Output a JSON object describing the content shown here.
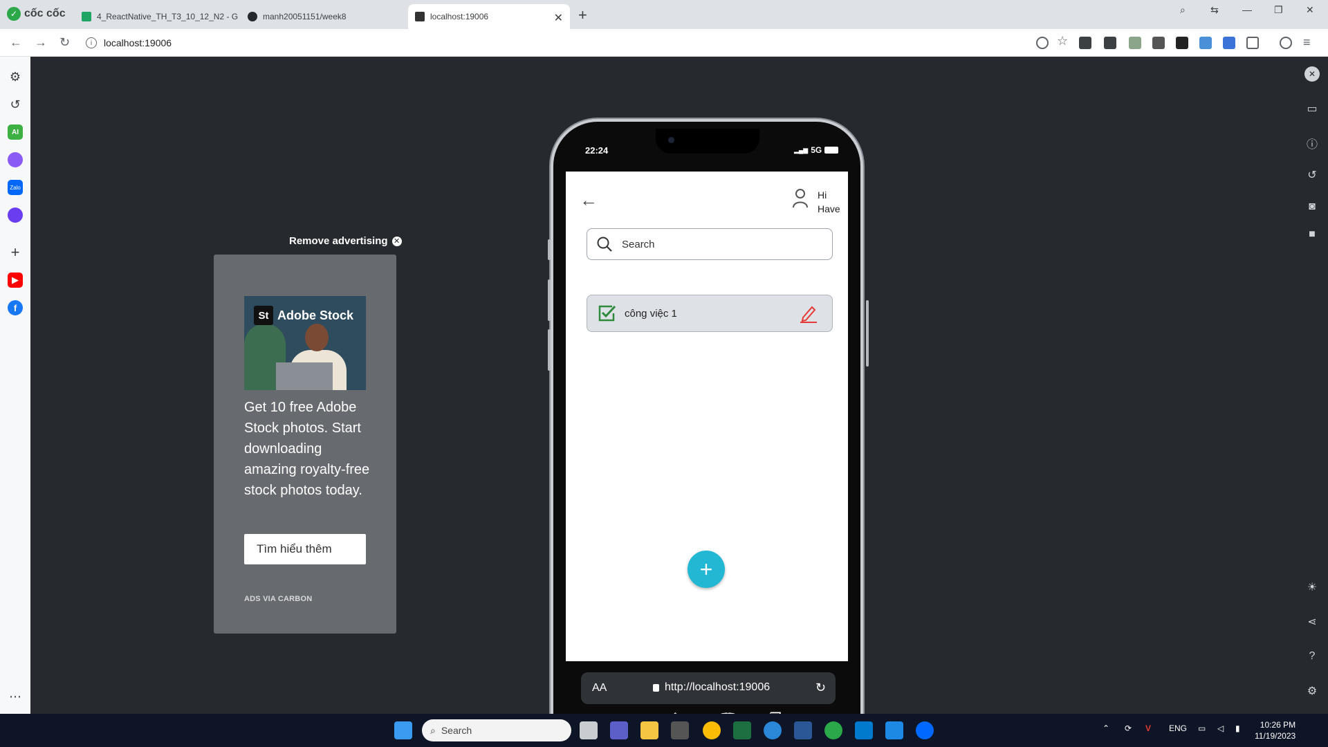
{
  "browser": {
    "brand": "cốc cốc",
    "tabs": [
      {
        "title": "4_ReactNative_TH_T3_10_12_N2 - Gc"
      },
      {
        "title": "manh20051151/week8"
      },
      {
        "title": "localhost:19006"
      }
    ],
    "address": "localhost:19006"
  },
  "ad": {
    "remove_label": "Remove advertising",
    "brand": "Adobe Stock",
    "brand_mark": "St",
    "text": "Get 10 free Adobe Stock photos. Start downloading amazing royalty-free stock photos today.",
    "button": "Tìm hiểu thêm",
    "footer": "ADS VIA CARBON"
  },
  "phone": {
    "time": "22:24",
    "network": "5G",
    "greeting_line1": "Hi",
    "greeting_line2": "Have",
    "search_placeholder": "Search",
    "tasks": [
      {
        "title": "công việc 1",
        "done": true
      }
    ],
    "safari": {
      "aa": "AA",
      "url": "http://localhost:19006"
    }
  },
  "taskbar": {
    "search": "Search",
    "lang": "ENG",
    "time": "10:26 PM",
    "date": "11/19/2023"
  },
  "colors": {
    "fab": "#22b7d3",
    "check": "#2e8b3a",
    "pencil": "#e53935",
    "stage": "#262a2e"
  }
}
